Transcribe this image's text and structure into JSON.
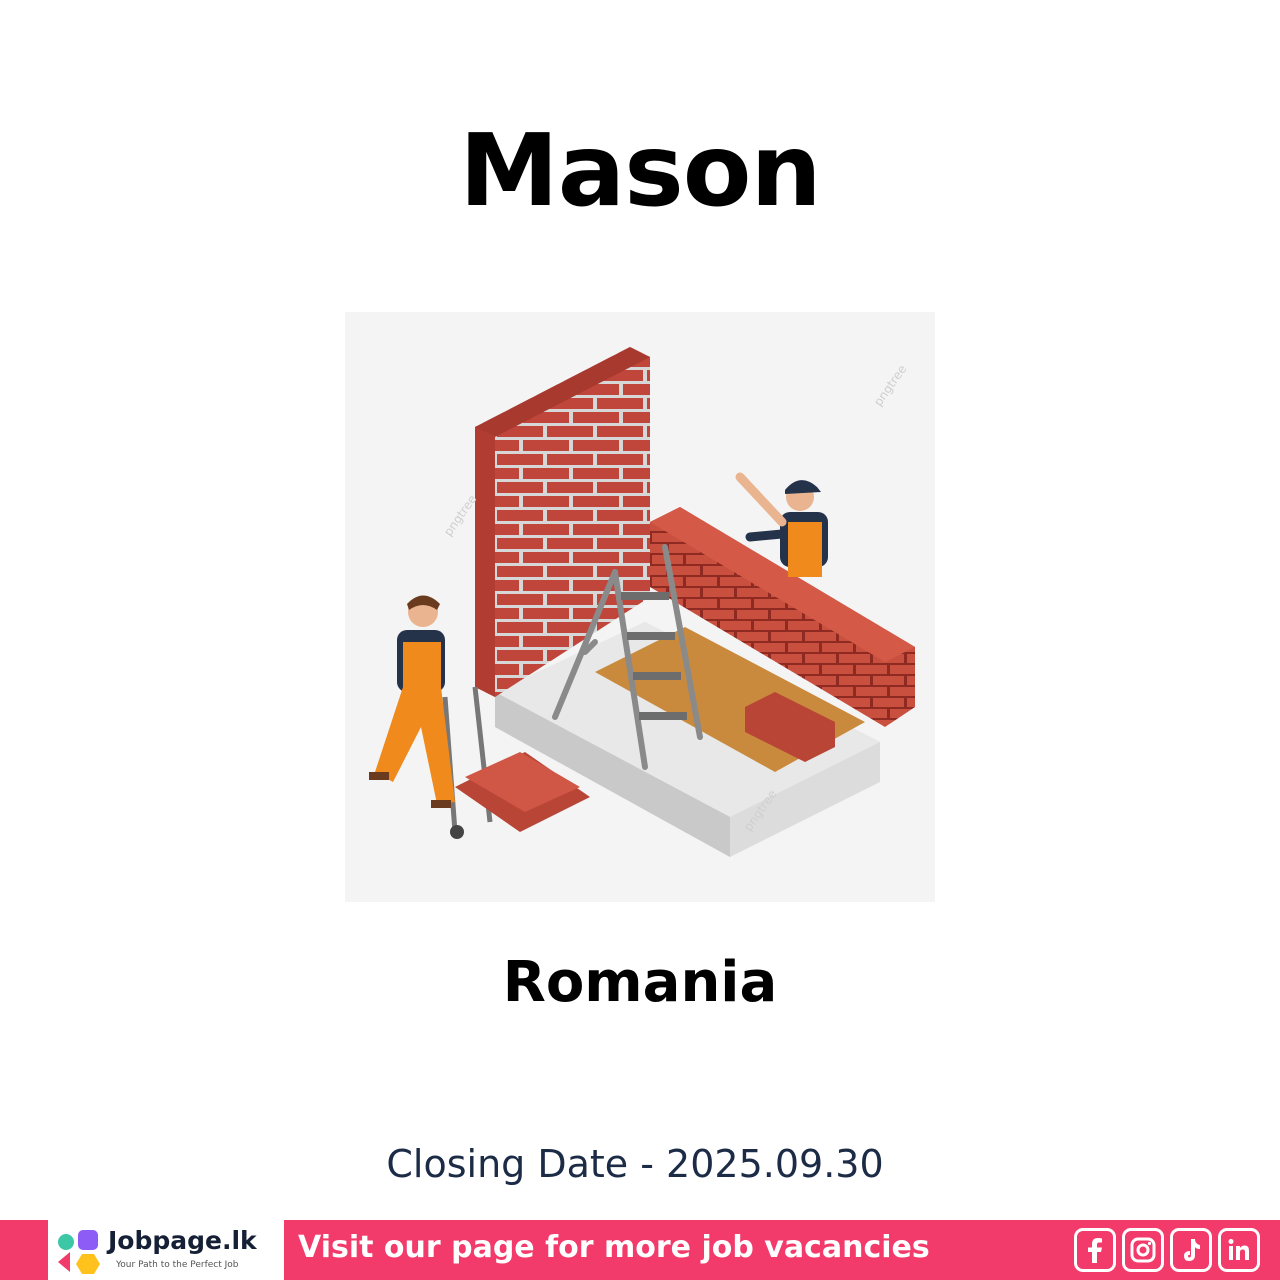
{
  "job": {
    "title": "Mason",
    "country": "Romania",
    "closing": "Closing Date - 2025.09.30"
  },
  "illustration": {
    "description_icon": "mason-bricklaying-illustration",
    "watermark": "pngtree"
  },
  "footer": {
    "brand_name": "Jobpage.lk",
    "brand_tagline": "Your Path to the Perfect Job",
    "cta": "Visit our page for more job vacancies",
    "social_icons": [
      "facebook-icon",
      "instagram-icon",
      "tiktok-icon",
      "linkedin-icon"
    ]
  },
  "colors": {
    "accent": "#f23b6a",
    "brick": "#c0453a",
    "worker_overall": "#f08a1c",
    "text_dark": "#1c2b46"
  }
}
